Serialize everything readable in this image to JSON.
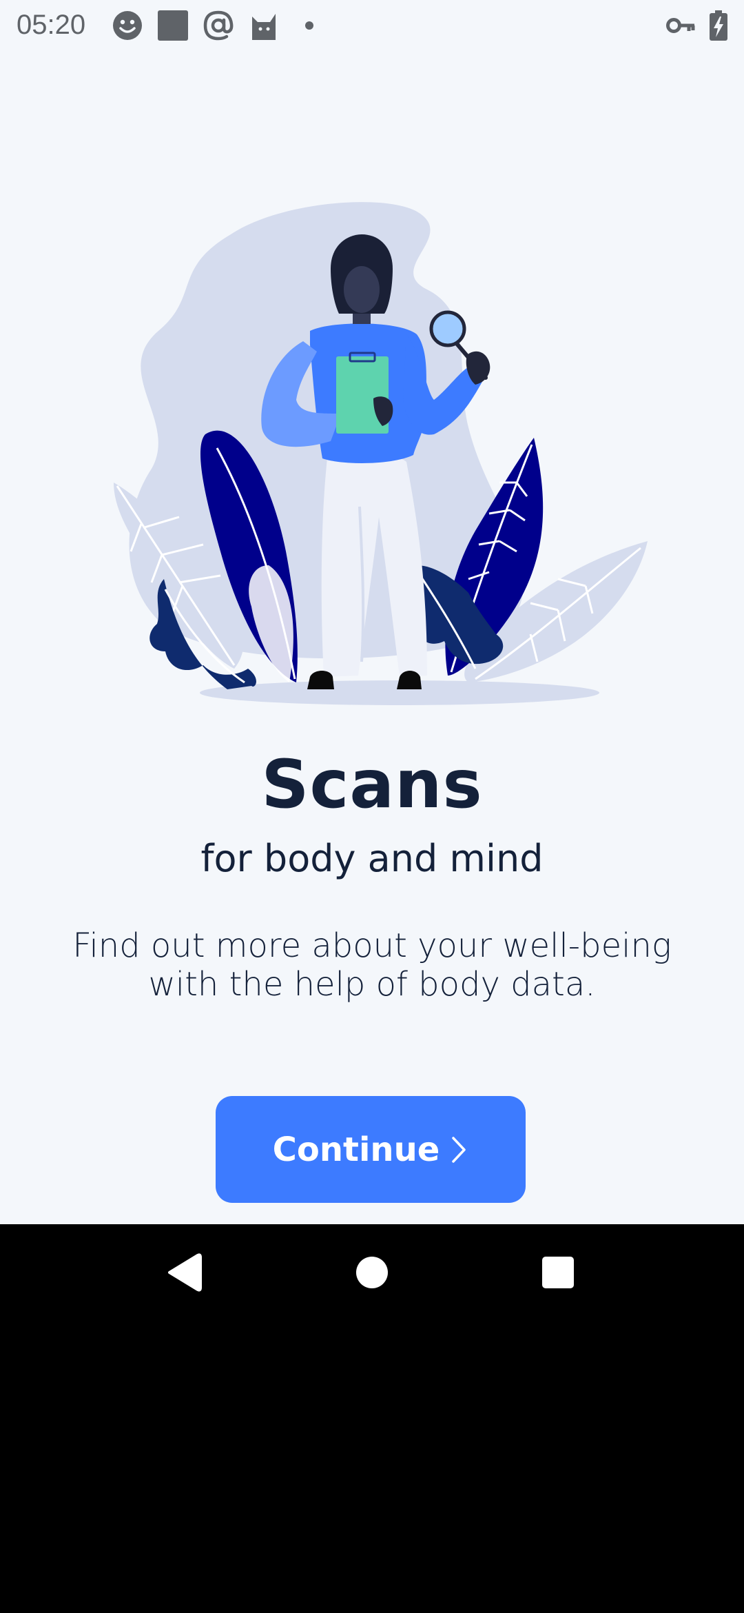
{
  "status_bar": {
    "time": "05:20",
    "icons": [
      "smiley-icon",
      "square-notification-icon",
      "at-sign-icon",
      "cat-icon",
      "dot-icon",
      "key-icon",
      "battery-charging-icon"
    ]
  },
  "onboarding": {
    "title": "Scans",
    "subtitle": "for body and mind",
    "description": "Find out more about your well-being with the help of body data.",
    "continue_label": "Continue"
  },
  "navigation_bar": {
    "icons": [
      "back-icon",
      "home-icon",
      "recents-icon"
    ]
  },
  "colors": {
    "background": "#f4f7fb",
    "accent": "#3d7bff",
    "text": "#14213a",
    "illustration_navy": "#00008b",
    "illustration_light": "#d5dcee"
  }
}
